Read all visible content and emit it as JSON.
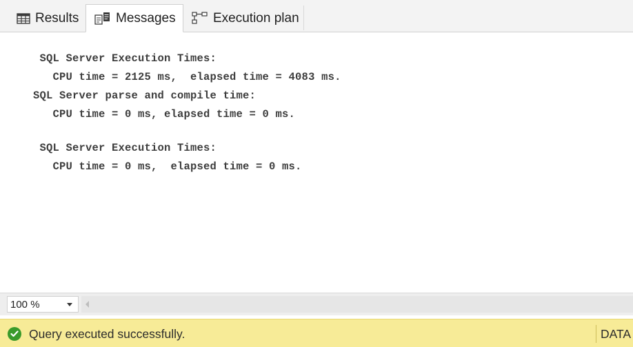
{
  "tabs": {
    "results": {
      "label": "Results",
      "icon": "grid-icon"
    },
    "messages": {
      "label": "Messages",
      "icon": "messages-icon",
      "active": true
    },
    "execution_plan": {
      "label": "Execution plan",
      "icon": "execution-plan-icon"
    }
  },
  "messages": {
    "lines": [
      " SQL Server Execution Times:",
      "   CPU time = 2125 ms,  elapsed time = 4083 ms.",
      "SQL Server parse and compile time:",
      "   CPU time = 0 ms, elapsed time = 0 ms.",
      " SQL Server Execution Times:",
      "   CPU time = 0 ms,  elapsed time = 0 ms."
    ]
  },
  "zoom": {
    "value": "100 %"
  },
  "status": {
    "message": "Query executed successfully.",
    "right_text": "DATA",
    "color": "#f7eb97",
    "success_icon": "check-circle-icon"
  }
}
